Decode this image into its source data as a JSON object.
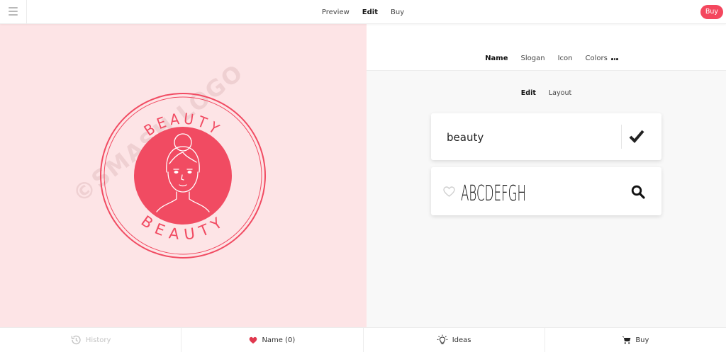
{
  "topbar": {
    "nav": [
      "Preview",
      "Edit",
      "Buy"
    ],
    "active_nav": "Edit",
    "buy_label": "Buy"
  },
  "preview": {
    "logo_top_text": "BEAUTY",
    "logo_bottom_text": "BEAUTY",
    "watermark": "©SMASH LOGO",
    "colors": {
      "background": "#fde4e6",
      "accent": "#f14b62"
    }
  },
  "editor": {
    "tabs": [
      "Name",
      "Slogan",
      "Icon",
      "Colors"
    ],
    "active_tab": "Name",
    "subtabs": [
      "Edit",
      "Layout"
    ],
    "active_subtab": "Edit",
    "name_value": "beauty",
    "font_sample": "ABCDEFGH"
  },
  "bottombar": {
    "history": "History",
    "name": "Name (0)",
    "ideas": "Ideas",
    "buy": "Buy"
  },
  "icons": [
    "menu-icon",
    "more-icon",
    "check-icon",
    "heart-icon",
    "search-icon",
    "history-icon",
    "heart-filled-icon",
    "lightbulb-icon",
    "cart-icon"
  ]
}
